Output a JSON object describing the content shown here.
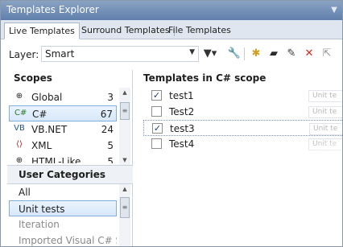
{
  "window": {
    "title": "Templates Explorer",
    "menu_icon": "dropdown-arrow-icon"
  },
  "tabs": [
    {
      "label": "Live Templates",
      "active": true
    },
    {
      "label": "Surround Templates",
      "active": false
    },
    {
      "label": "File Templates",
      "active": false
    }
  ],
  "toolbar": {
    "layer_label": "Layer:",
    "layer_value": "Smart",
    "icons": [
      "filter-icon",
      "wrench-icon",
      "new-template-icon",
      "new-folder-icon",
      "edit-icon",
      "delete-icon",
      "export-icon"
    ]
  },
  "scopes": {
    "heading": "Scopes",
    "items": [
      {
        "name": "Global",
        "count": "3",
        "icon": "crosshair-icon",
        "selected": false
      },
      {
        "name": "C#",
        "count": "67",
        "icon": "csharp-icon",
        "selected": true
      },
      {
        "name": "VB.NET",
        "count": "24",
        "icon": "vbnet-icon",
        "selected": false
      },
      {
        "name": "XML",
        "count": "5",
        "icon": "xml-icon",
        "selected": false
      },
      {
        "name": "HTML-Like",
        "count": "5",
        "icon": "html-icon",
        "selected": false
      }
    ]
  },
  "categories": {
    "heading": "User Categories",
    "items": [
      {
        "name": "All",
        "selected": false,
        "dim": false
      },
      {
        "name": "Unit tests",
        "selected": true,
        "dim": false
      },
      {
        "name": "Iteration",
        "selected": false,
        "dim": true
      },
      {
        "name": "Imported Visual C# Sni",
        "selected": false,
        "dim": true
      }
    ]
  },
  "templates": {
    "heading": "Templates in C# scope",
    "rows": [
      {
        "name": "test1",
        "checked": true,
        "category": "Unit te",
        "focused": false
      },
      {
        "name": "Test2",
        "checked": false,
        "category": "Unit te",
        "focused": false
      },
      {
        "name": "test3",
        "checked": true,
        "category": "Unit te",
        "focused": true
      },
      {
        "name": "Test4",
        "checked": false,
        "category": "Unit te",
        "focused": false
      }
    ]
  }
}
